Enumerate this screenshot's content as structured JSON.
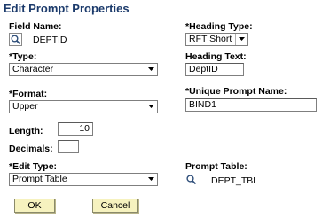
{
  "page": {
    "title": "Edit Prompt Properties"
  },
  "field_name": {
    "label": "Field Name:",
    "value": "DEPTID",
    "lookup_icon": "magnifier-lookup-icon"
  },
  "heading_type": {
    "label": "*Heading Type:",
    "selected": "RFT Short"
  },
  "type": {
    "label": "*Type:",
    "selected": "Character"
  },
  "heading_text": {
    "label": "Heading Text:",
    "value": "DeptID"
  },
  "format": {
    "label": "*Format:",
    "selected": "Upper"
  },
  "unique_prompt_name": {
    "label": "*Unique Prompt Name:",
    "value": "BIND1"
  },
  "length": {
    "label": "Length:",
    "value": "10"
  },
  "decimals": {
    "label": "Decimals:",
    "value": ""
  },
  "edit_type": {
    "label": "*Edit Type:",
    "selected": "Prompt Table"
  },
  "prompt_table": {
    "label": "Prompt Table:",
    "value": "DEPT_TBL",
    "lookup_icon": "magnifier-icon"
  },
  "buttons": {
    "ok": "OK",
    "cancel": "Cancel"
  },
  "colors": {
    "title": "#1b3a6b",
    "button_bg": "#f6f2bf"
  }
}
